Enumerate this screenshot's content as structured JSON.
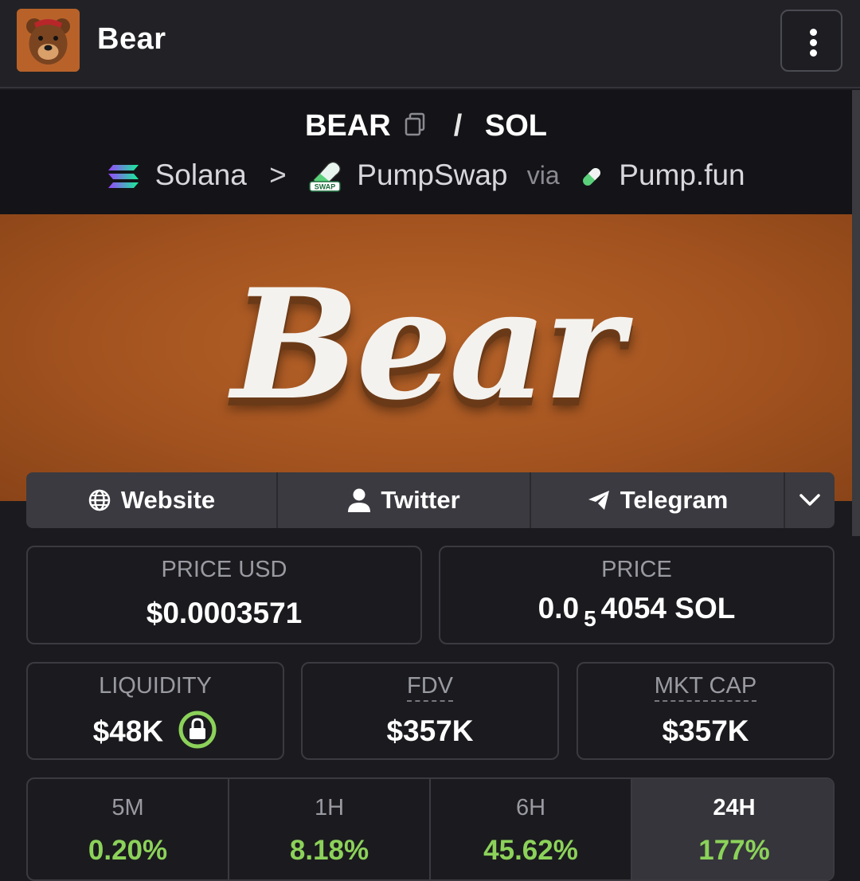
{
  "header": {
    "title": "Bear",
    "logo_icon": "bear-avatar-icon",
    "menu_icon": "vertical-dots-icon"
  },
  "pair": {
    "base": "BEAR",
    "separator": "/",
    "quote": "SOL"
  },
  "route": {
    "chain": "Solana",
    "arrow": ">",
    "dex": "PumpSwap",
    "via": "via",
    "launchpad": "Pump.fun",
    "dex_badge": "SWAP"
  },
  "banner": {
    "wordmark": "Bear"
  },
  "links": {
    "website": "Website",
    "twitter": "Twitter",
    "telegram": "Telegram"
  },
  "stats": {
    "price_usd_label": "PRICE USD",
    "price_usd": "$0.0003571",
    "price_label": "PRICE",
    "price_prefix": "0.0",
    "price_zeros": "5",
    "price_rest": "4054 SOL",
    "liquidity_label": "LIQUIDITY",
    "liquidity": "$48K",
    "fdv_label": "FDV",
    "fdv": "$357K",
    "mktcap_label": "MKT CAP",
    "mktcap": "$357K"
  },
  "changes": [
    {
      "period": "5M",
      "value": "0.20%"
    },
    {
      "period": "1H",
      "value": "8.18%"
    },
    {
      "period": "6H",
      "value": "45.62%"
    },
    {
      "period": "24H",
      "value": "177%"
    }
  ],
  "colors": {
    "positive": "#8cd25a",
    "banner": "#a3531f",
    "lock_ring": "#8cd25a"
  }
}
